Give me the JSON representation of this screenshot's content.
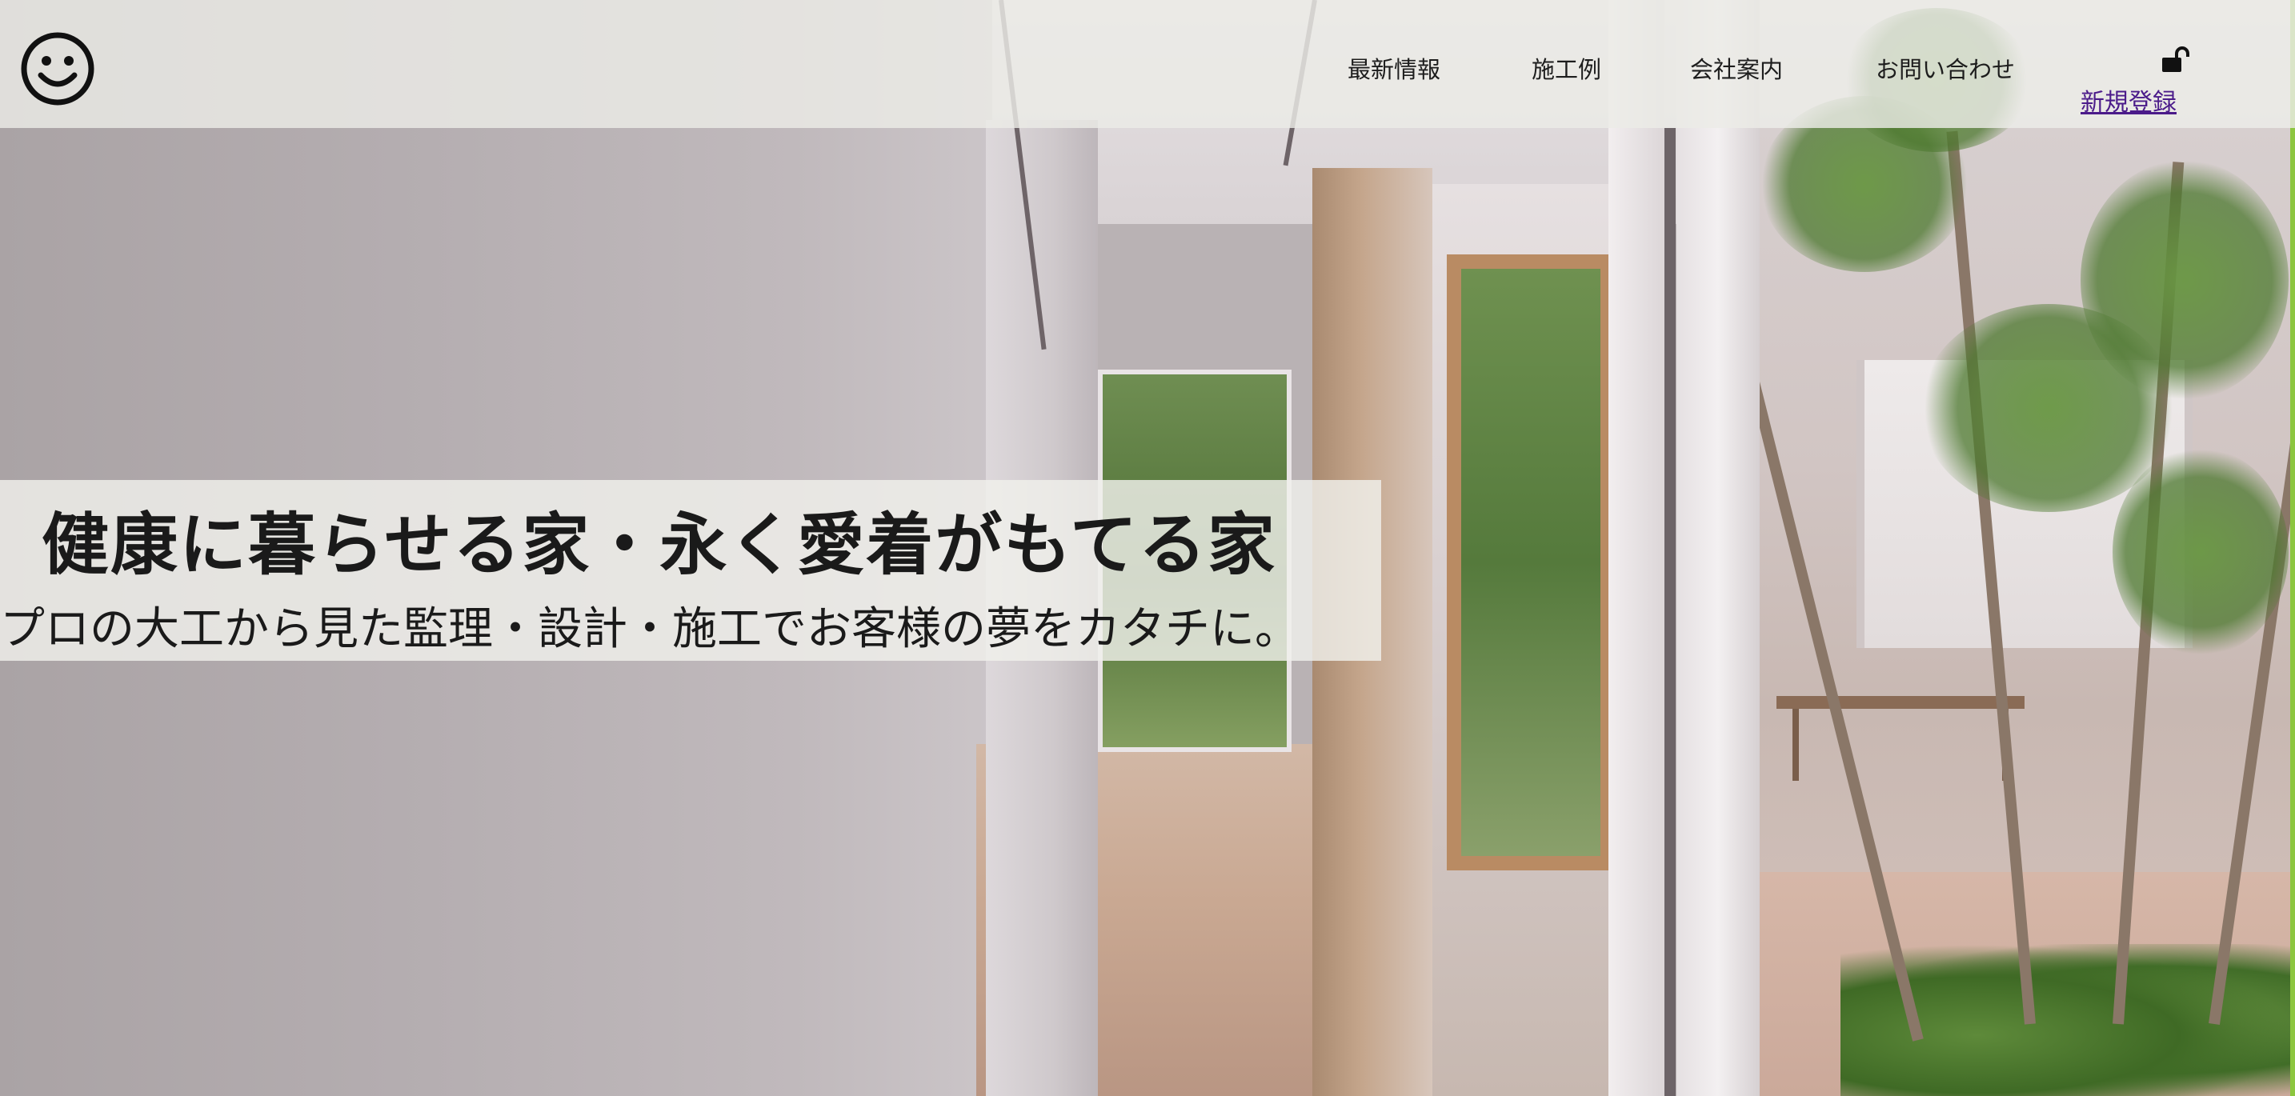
{
  "header": {
    "logo_icon": "smiley-face-icon",
    "nav": {
      "news": "最新情報",
      "works": "施工例",
      "company": "会社案内",
      "contact": "お問い合わせ"
    },
    "account": {
      "icon": "unlock-icon",
      "signup_label": "新規登録"
    }
  },
  "hero": {
    "title": "健康に暮らせる家・永く愛着がもてる家",
    "subtitle": "プロの大工から見た監理・設計・施工でお客様の夢をカタチに。"
  },
  "colors": {
    "header_bg": "#ECECE6",
    "text": "#1A1A1A",
    "link": "#4B1B8A",
    "accent_edge": "#8CC63F"
  }
}
